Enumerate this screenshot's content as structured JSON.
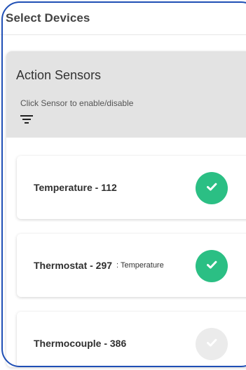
{
  "header": {
    "title": "Select Devices"
  },
  "card": {
    "title": "Action Sensors",
    "subtitle": "Click Sensor to enable/disable",
    "filter_icon": "filter-icon"
  },
  "sensors": [
    {
      "name": "Temperature - 112",
      "subtitle": "",
      "enabled": true,
      "icon": "check-icon"
    },
    {
      "name": "Thermostat - 297",
      "subtitle": ": Temperature",
      "enabled": true,
      "icon": "check-icon"
    },
    {
      "name": "Thermocouple - 386",
      "subtitle": "",
      "enabled": false,
      "icon": "check-icon"
    }
  ],
  "colors": {
    "accent_green": "#2bbf84",
    "disabled_gray": "#ebebeb",
    "header_gray": "#e3e3e3",
    "outline_blue": "#1f4fb5"
  }
}
